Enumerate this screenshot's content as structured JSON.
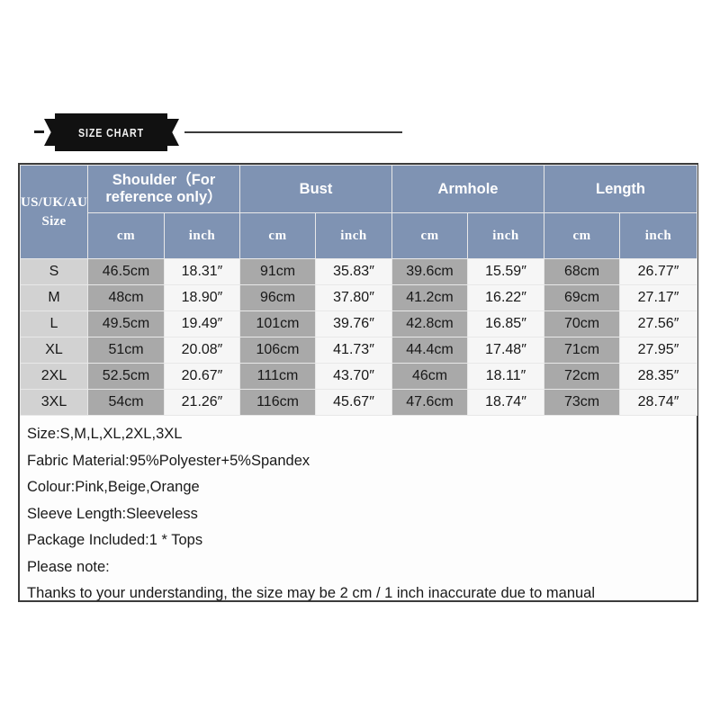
{
  "banner": {
    "label": "SIZE CHART"
  },
  "table": {
    "group_headers": [
      {
        "label": "Size",
        "span": 1
      },
      {
        "label": "Shoulder（For reference only）",
        "span": 2
      },
      {
        "label": "Bust",
        "span": 2
      },
      {
        "label": "Armhole",
        "span": 2
      },
      {
        "label": "Length",
        "span": 2
      }
    ],
    "size_sub_header": "US/UK/AU\nSize",
    "size_sub_header_line1": "US/UK/AU",
    "size_sub_header_line2": "Size",
    "unit_headers": [
      "cm",
      "inch",
      "cm",
      "inch",
      "cm",
      "inch",
      "cm",
      "inch"
    ],
    "rows": [
      {
        "size": "S",
        "shoulder_cm": "46.5cm",
        "shoulder_inch": "18.31″",
        "bust_cm": "91cm",
        "bust_inch": "35.83″",
        "armhole_cm": "39.6cm",
        "armhole_inch": "15.59″",
        "length_cm": "68cm",
        "length_inch": "26.77″"
      },
      {
        "size": "M",
        "shoulder_cm": "48cm",
        "shoulder_inch": "18.90″",
        "bust_cm": "96cm",
        "bust_inch": "37.80″",
        "armhole_cm": "41.2cm",
        "armhole_inch": "16.22″",
        "length_cm": "69cm",
        "length_inch": "27.17″"
      },
      {
        "size": "L",
        "shoulder_cm": "49.5cm",
        "shoulder_inch": "19.49″",
        "bust_cm": "101cm",
        "bust_inch": "39.76″",
        "armhole_cm": "42.8cm",
        "armhole_inch": "16.85″",
        "length_cm": "70cm",
        "length_inch": "27.56″"
      },
      {
        "size": "XL",
        "shoulder_cm": "51cm",
        "shoulder_inch": "20.08″",
        "bust_cm": "106cm",
        "bust_inch": "41.73″",
        "armhole_cm": "44.4cm",
        "armhole_inch": "17.48″",
        "length_cm": "71cm",
        "length_inch": "27.95″"
      },
      {
        "size": "2XL",
        "shoulder_cm": "52.5cm",
        "shoulder_inch": "20.67″",
        "bust_cm": "111cm",
        "bust_inch": "43.70″",
        "armhole_cm": "46cm",
        "armhole_inch": "18.11″",
        "length_cm": "72cm",
        "length_inch": "28.35″"
      },
      {
        "size": "3XL",
        "shoulder_cm": "54cm",
        "shoulder_inch": "21.26″",
        "bust_cm": "116cm",
        "bust_inch": "45.67″",
        "armhole_cm": "47.6cm",
        "armhole_inch": "18.74″",
        "length_cm": "73cm",
        "length_inch": "28.74″"
      }
    ]
  },
  "description": {
    "lines": [
      "Size:S,M,L,XL,2XL,3XL",
      "Fabric Material:95%Polyester+5%Spandex",
      "Colour:Pink,Beige,Orange",
      "Sleeve Length:Sleeveless",
      "Package Included:1 * Tops",
      "Please note:",
      "Thanks to your understanding, the size may be 2 cm / 1 inch inaccurate due to manual"
    ]
  },
  "colors": {
    "header_blue": "#7f93b3",
    "cm_cell_gray": "#a9a9a9",
    "inch_cell_gray": "#f6f6f6",
    "size_cell_gray": "#d2d2d2",
    "ribbon_black": "#111111",
    "frame_border": "#3c3c3c"
  }
}
